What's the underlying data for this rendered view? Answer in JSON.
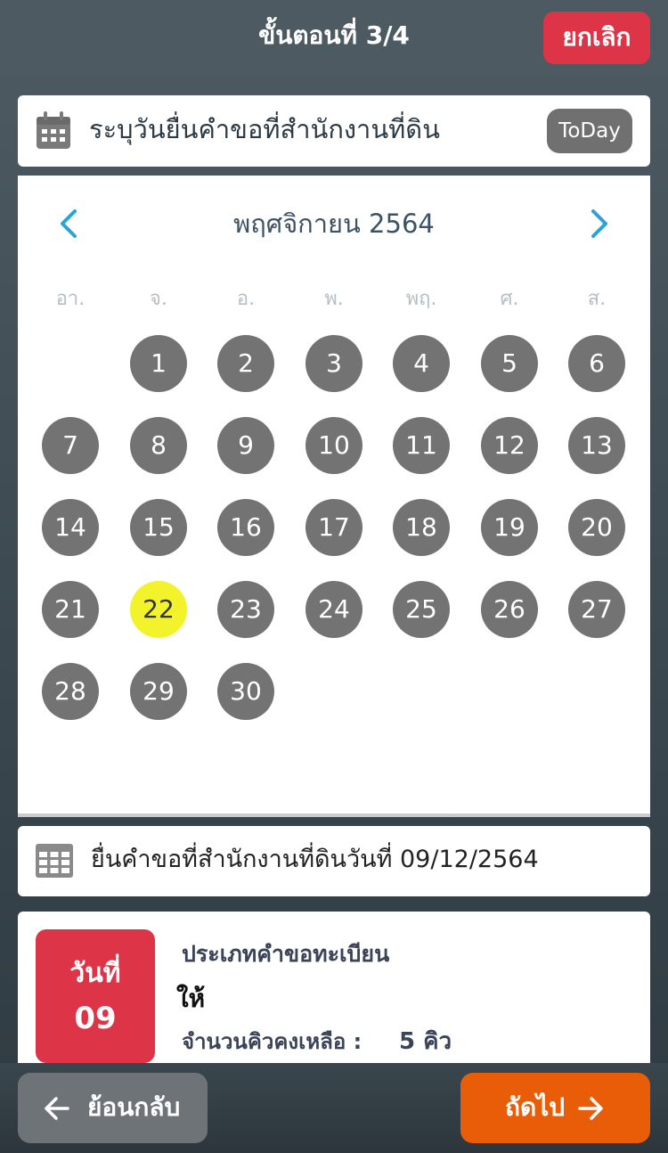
{
  "header": {
    "step_title": "ขั้นตอนที่ 3/4",
    "cancel_label": "ยกเลิก"
  },
  "date_picker": {
    "label": "ระบุวันยื่นคำขอที่สำนักงานที่ดิน",
    "today_label": "ToDay",
    "icon": "calendar-icon"
  },
  "calendar": {
    "month_title": "พฤศจิกายน 2564",
    "prev_icon": "chevron-left-icon",
    "next_icon": "chevron-right-icon",
    "weekdays": [
      "อา.",
      "จ.",
      "อ.",
      "พ.",
      "พฤ.",
      "ศ.",
      "ส."
    ],
    "start_weekday_index": 1,
    "days_in_month": 30,
    "selected_day": 22,
    "colors": {
      "day": "#737373",
      "selected": "#f3f32b"
    }
  },
  "summary": {
    "text": "ยื่นคำขอที่สำนักงานที่ดินวันที่ 09/12/2564",
    "icon": "grid-icon"
  },
  "detail": {
    "badge_label": "วันที่",
    "badge_value": "09",
    "type_label": "ประเภทคำขอทะเบียน",
    "type_value": "ให้",
    "queue_label": "จำนวนคิวคงเหลือ :",
    "queue_value": "5 คิว"
  },
  "footer": {
    "back_label": "ย้อนกลับ",
    "next_label": "ถัดไป",
    "back_icon": "arrow-left-icon",
    "next_icon": "arrow-right-icon",
    "colors": {
      "back": "#6e7378",
      "next": "#ea5d08",
      "cancel": "#dd3547"
    }
  }
}
